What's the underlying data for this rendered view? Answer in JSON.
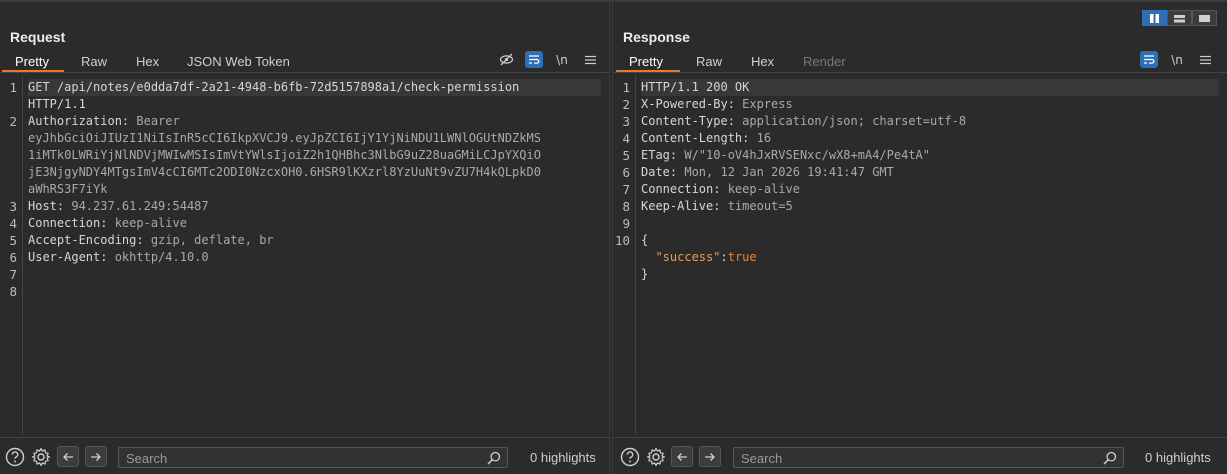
{
  "request": {
    "title": "Request",
    "tabs": [
      "Pretty",
      "Raw",
      "Hex",
      "JSON Web Token"
    ],
    "lines": [
      {
        "n": "1",
        "parts": [
          {
            "t": "GET /api/notes/e0dda7df-2a21-4948-b6fb-72d5157898a1/check-permission",
            "c": "k"
          }
        ]
      },
      {
        "n": "",
        "parts": [
          {
            "t": "HTTP/1.1",
            "c": "k"
          }
        ]
      },
      {
        "n": "2",
        "parts": [
          {
            "t": "Authorization:",
            "c": "k"
          },
          {
            "t": " Bearer",
            "c": "v"
          }
        ]
      },
      {
        "n": "",
        "parts": [
          {
            "t": "eyJhbGciOiJIUzI1NiIsInR5cCI6IkpXVCJ9.eyJpZCI6IjY1YjNiNDU1LWNlOGUtNDZkMS",
            "c": "v"
          }
        ]
      },
      {
        "n": "",
        "parts": [
          {
            "t": "1iMTk0LWRiYjNlNDVjMWIwMSIsImVtYWlsIjoiZ2h1QHBhc3NlbG9uZ28uaGMiLCJpYXQiO",
            "c": "v"
          }
        ]
      },
      {
        "n": "",
        "parts": [
          {
            "t": "jE3NjgyNDY4MTgsImV4cCI6MTc2ODI0NzcxOH0.6HSR9lKXzrl8YzUuNt9vZU7H4kQLpkD0",
            "c": "v"
          }
        ]
      },
      {
        "n": "",
        "parts": [
          {
            "t": "aWhRS3F7iYk",
            "c": "v"
          }
        ]
      },
      {
        "n": "3",
        "parts": [
          {
            "t": "Host:",
            "c": "k"
          },
          {
            "t": " 94.237.61.249:54487",
            "c": "v"
          }
        ]
      },
      {
        "n": "4",
        "parts": [
          {
            "t": "Connection:",
            "c": "k"
          },
          {
            "t": " keep-alive",
            "c": "v"
          }
        ]
      },
      {
        "n": "5",
        "parts": [
          {
            "t": "Accept-Encoding:",
            "c": "k"
          },
          {
            "t": " gzip, deflate, br",
            "c": "v"
          }
        ]
      },
      {
        "n": "6",
        "parts": [
          {
            "t": "User-Agent:",
            "c": "k"
          },
          {
            "t": " okhttp/4.10.0",
            "c": "v"
          }
        ]
      },
      {
        "n": "7",
        "parts": []
      },
      {
        "n": "8",
        "parts": []
      }
    ],
    "search_placeholder": "Search",
    "highlights": "0 highlights"
  },
  "response": {
    "title": "Response",
    "tabs": [
      "Pretty",
      "Raw",
      "Hex",
      "Render"
    ],
    "lines": [
      {
        "n": "1",
        "parts": [
          {
            "t": "HTTP/1.1 200 OK",
            "c": "k"
          }
        ]
      },
      {
        "n": "2",
        "parts": [
          {
            "t": "X-Powered-By:",
            "c": "k"
          },
          {
            "t": " Express",
            "c": "v"
          }
        ]
      },
      {
        "n": "3",
        "parts": [
          {
            "t": "Content-Type:",
            "c": "k"
          },
          {
            "t": " application/json; charset=utf-8",
            "c": "v"
          }
        ]
      },
      {
        "n": "4",
        "parts": [
          {
            "t": "Content-Length:",
            "c": "k"
          },
          {
            "t": " 16",
            "c": "v"
          }
        ]
      },
      {
        "n": "5",
        "parts": [
          {
            "t": "ETag:",
            "c": "k"
          },
          {
            "t": " W/\"10-oV4hJxRVSENxc/wX8+mA4/Pe4tA\"",
            "c": "v"
          }
        ]
      },
      {
        "n": "6",
        "parts": [
          {
            "t": "Date:",
            "c": "k"
          },
          {
            "t": " Mon, 12 Jan 2026 19:41:47 GMT",
            "c": "v"
          }
        ]
      },
      {
        "n": "7",
        "parts": [
          {
            "t": "Connection:",
            "c": "k"
          },
          {
            "t": " keep-alive",
            "c": "v"
          }
        ]
      },
      {
        "n": "8",
        "parts": [
          {
            "t": "Keep-Alive:",
            "c": "k"
          },
          {
            "t": " timeout=5",
            "c": "v"
          }
        ]
      },
      {
        "n": "9",
        "parts": []
      },
      {
        "n": "10",
        "parts": [
          {
            "t": "{",
            "c": "k"
          }
        ]
      },
      {
        "n": "",
        "parts": [
          {
            "t": "  \"success\"",
            "c": "jkey"
          },
          {
            "t": ":",
            "c": "k"
          },
          {
            "t": "true",
            "c": "jval"
          }
        ]
      },
      {
        "n": "",
        "parts": [
          {
            "t": "}",
            "c": "k"
          }
        ]
      }
    ],
    "search_placeholder": "Search",
    "highlights": "0 highlights"
  },
  "toolbar_icons": {
    "hide": "eye-slash-icon",
    "wrap": "word-wrap-icon",
    "newline": "\\n",
    "menu": "hamburger-menu-icon"
  },
  "colors": {
    "accent_tab": "#e8792c",
    "active_blue": "#2f6fb6"
  }
}
